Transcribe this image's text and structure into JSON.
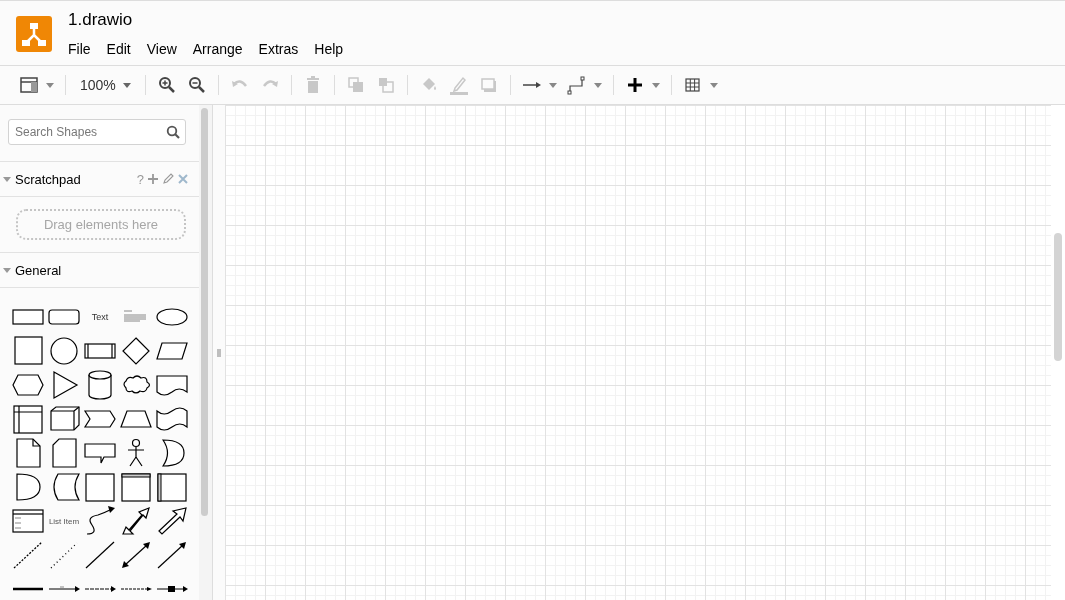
{
  "window": {
    "title": "1.drawio"
  },
  "menu": [
    "File",
    "Edit",
    "View",
    "Arrange",
    "Extras",
    "Help"
  ],
  "toolbar": [
    {
      "kind": "format",
      "disabled": false,
      "caret": true
    },
    {
      "kind": "sep"
    },
    {
      "kind": "zoom",
      "label": "100%",
      "caret": true
    },
    {
      "kind": "sep"
    },
    {
      "kind": "zoomin",
      "disabled": false
    },
    {
      "kind": "zoomout",
      "disabled": false
    },
    {
      "kind": "sep"
    },
    {
      "kind": "undo",
      "disabled": true
    },
    {
      "kind": "redo",
      "disabled": true
    },
    {
      "kind": "sep"
    },
    {
      "kind": "delete",
      "disabled": true
    },
    {
      "kind": "sep"
    },
    {
      "kind": "tofront",
      "disabled": true
    },
    {
      "kind": "toback",
      "disabled": true
    },
    {
      "kind": "sep"
    },
    {
      "kind": "fill",
      "disabled": true
    },
    {
      "kind": "linecolor",
      "disabled": true
    },
    {
      "kind": "shadow",
      "disabled": true
    },
    {
      "kind": "sep"
    },
    {
      "kind": "connection",
      "disabled": false,
      "caret": true
    },
    {
      "kind": "waypoints",
      "disabled": false,
      "caret": true
    },
    {
      "kind": "sep"
    },
    {
      "kind": "insert",
      "disabled": false,
      "caret": true
    },
    {
      "kind": "sep"
    },
    {
      "kind": "table",
      "disabled": false,
      "caret": true
    }
  ],
  "search": {
    "placeholder": "Search Shapes"
  },
  "scratchpad": {
    "title": "Scratchpad",
    "expanded": true,
    "help": "?",
    "drop_hint": "Drag elements here"
  },
  "general": {
    "title": "General",
    "expanded": true
  },
  "shapes": [
    {
      "kind": "rect"
    },
    {
      "kind": "rounded"
    },
    {
      "kind": "text",
      "label": "Text"
    },
    {
      "kind": "heading"
    },
    {
      "kind": "ellipse"
    },
    {
      "kind": "square"
    },
    {
      "kind": "circle"
    },
    {
      "kind": "process"
    },
    {
      "kind": "diamond"
    },
    {
      "kind": "parallelogram"
    },
    {
      "kind": "hexagon"
    },
    {
      "kind": "triangle"
    },
    {
      "kind": "cylinder"
    },
    {
      "kind": "cloud"
    },
    {
      "kind": "document"
    },
    {
      "kind": "storage"
    },
    {
      "kind": "cube"
    },
    {
      "kind": "step"
    },
    {
      "kind": "trapezoid"
    },
    {
      "kind": "tape"
    },
    {
      "kind": "note"
    },
    {
      "kind": "card"
    },
    {
      "kind": "callout"
    },
    {
      "kind": "actor"
    },
    {
      "kind": "or"
    },
    {
      "kind": "delay"
    },
    {
      "kind": "datastore"
    },
    {
      "kind": "container"
    },
    {
      "kind": "window"
    },
    {
      "kind": "vcontainer"
    },
    {
      "kind": "list"
    },
    {
      "kind": "listitem",
      "label": "List Item"
    },
    {
      "kind": "curve"
    },
    {
      "kind": "doublearrow"
    },
    {
      "kind": "arrow"
    },
    {
      "kind": "dashed"
    },
    {
      "kind": "dotted"
    },
    {
      "kind": "line"
    },
    {
      "kind": "biline"
    },
    {
      "kind": "dirline"
    },
    {
      "kind": "thick"
    },
    {
      "kind": "conn1"
    },
    {
      "kind": "conn2"
    },
    {
      "kind": "conn3"
    },
    {
      "kind": "conn4"
    }
  ]
}
